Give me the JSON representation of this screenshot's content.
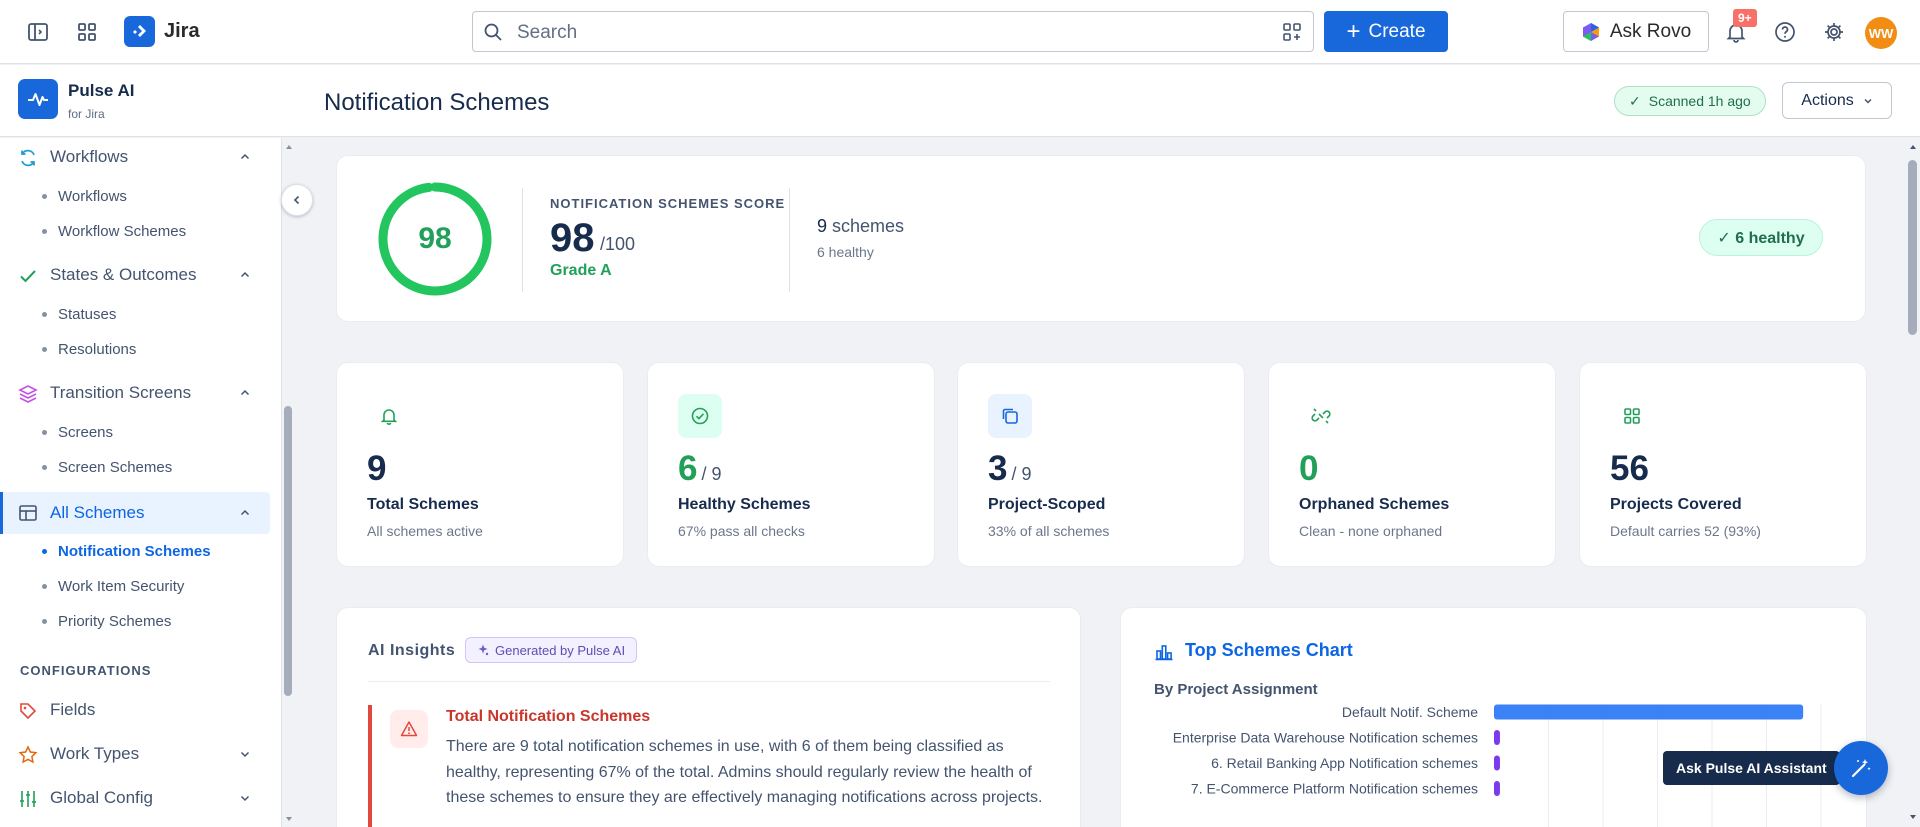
{
  "topbar": {
    "product": "Jira",
    "search_placeholder": "Search",
    "create_label": "Create",
    "ask_rovo_label": "Ask Rovo",
    "notifications_count": "9+",
    "avatar_initials": "WW"
  },
  "app": {
    "name": "Pulse AI",
    "subtitle": "for Jira",
    "page_title": "Notification Schemes",
    "scan_status": "Scanned 1h ago",
    "actions_label": "Actions"
  },
  "sidebar": {
    "groups": [
      {
        "label": "Workflows",
        "children": [
          "Workflows",
          "Workflow Schemes"
        ]
      },
      {
        "label": "States & Outcomes",
        "children": [
          "Statuses",
          "Resolutions"
        ]
      },
      {
        "label": "Transition Screens",
        "children": [
          "Screens",
          "Screen Schemes"
        ]
      },
      {
        "label": "All Schemes",
        "children": [
          "Notification Schemes",
          "Work Item Security",
          "Priority Schemes"
        ]
      }
    ],
    "section_label": "CONFIGURATIONS",
    "config_items": [
      {
        "label": "Fields"
      },
      {
        "label": "Work Types"
      },
      {
        "label": "Global Config"
      }
    ]
  },
  "score": {
    "value": 98,
    "value_text": "98",
    "kicker": "NOTIFICATION SCHEMES SCORE",
    "out_of": "/100",
    "grade": "Grade A",
    "schemes_count": "9",
    "schemes_word": "schemes",
    "healthy_line": "6 healthy",
    "healthy_pill": "✓ 6 healthy",
    "ring_color": "#22c55e"
  },
  "stats": [
    {
      "value": "9",
      "of": "",
      "label": "Total Schemes",
      "sub": "All schemes active",
      "icon": "bell-icon"
    },
    {
      "value": "6",
      "of": "/ 9",
      "label": "Healthy Schemes",
      "sub": "67% pass all checks",
      "icon": "check-circle-icon"
    },
    {
      "value": "3",
      "of": "/ 9",
      "label": "Project-Scoped",
      "sub": "33% of all schemes",
      "icon": "copy-icon"
    },
    {
      "value": "0",
      "of": "",
      "label": "Orphaned Schemes",
      "sub": "Clean - none orphaned",
      "icon": "unlink-icon"
    },
    {
      "value": "56",
      "of": "",
      "label": "Projects Covered",
      "sub": "Default carries 52 (93%)",
      "icon": "grid-icon"
    }
  ],
  "insights": {
    "title": "AI Insights",
    "badge": "Generated by Pulse AI",
    "items": [
      {
        "title": "Total Notification Schemes",
        "body": "There are 9 total notification schemes in use, with 6 of them being classified as healthy, representing 67% of the total. Admins should regularly review the health of these schemes to ensure they are effectively managing notifications across projects."
      }
    ]
  },
  "chart_panel": {
    "title": "Top Schemes Chart",
    "subtitle": "By Project Assignment"
  },
  "chart_data": {
    "type": "bar",
    "orientation": "horizontal",
    "categories": [
      "Default Notif. Scheme",
      "Enterprise Data Warehouse Notification schemes",
      "6. Retail Banking App Notification schemes",
      "7. E-Commerce Platform Notification schemes"
    ],
    "values": [
      52,
      1,
      1,
      1
    ],
    "xlim": [
      0,
      55
    ],
    "colors": [
      "#3b82f6",
      "#7c3aed",
      "#7c3aed",
      "#7c3aed"
    ],
    "grid": true
  },
  "assistant": {
    "tooltip": "Ask Pulse AI Assistant"
  }
}
